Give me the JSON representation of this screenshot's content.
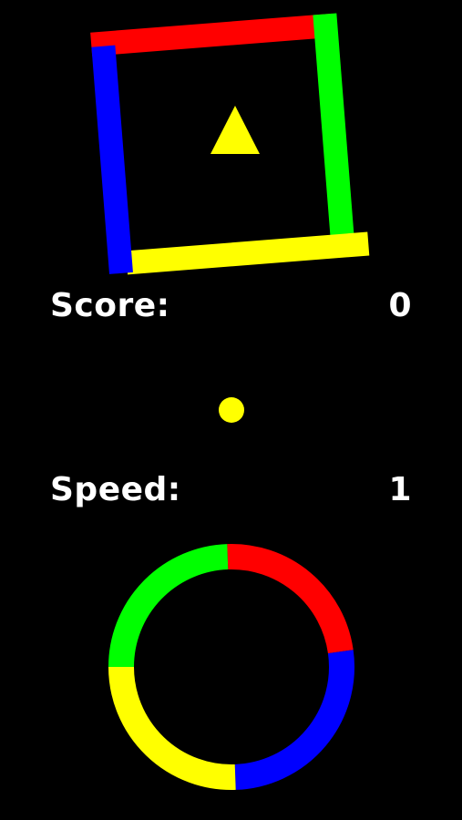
{
  "hud": {
    "score_label": "Score:",
    "score_value": "0",
    "speed_label": "Speed:",
    "speed_value": "1"
  },
  "colors": {
    "background": "#000000",
    "red": "#ff0000",
    "green": "#00ff00",
    "blue": "#0000ff",
    "yellow": "#ffff00",
    "text": "#ffffff"
  },
  "square_obstacle": {
    "sides": [
      "red",
      "green",
      "yellow",
      "blue"
    ]
  },
  "ring_obstacle": {
    "segments": [
      "red",
      "blue",
      "yellow",
      "green"
    ]
  },
  "player_ball": {
    "color": "yellow"
  },
  "star": {
    "shape": "triangle",
    "color": "yellow"
  }
}
